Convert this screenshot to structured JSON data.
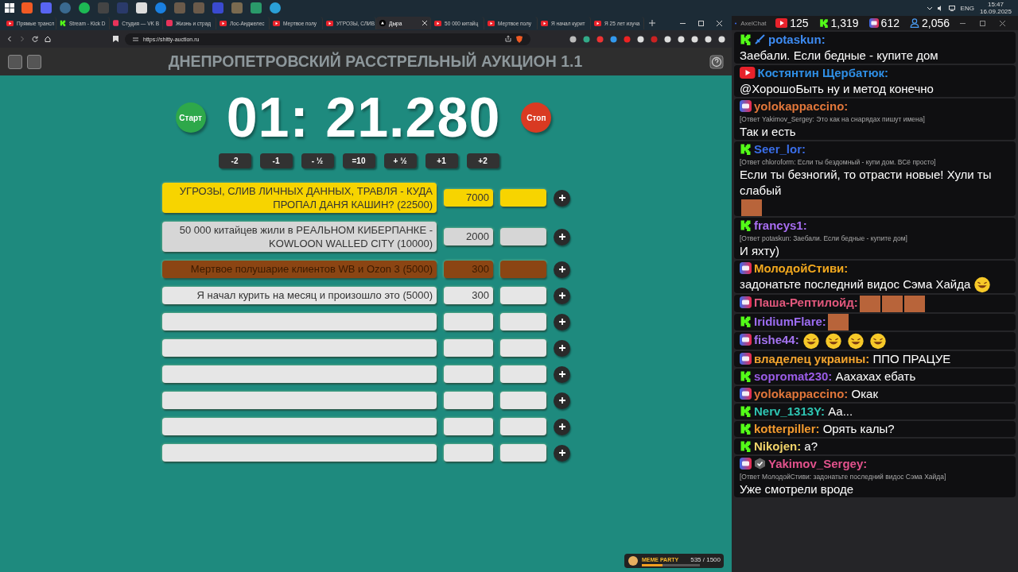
{
  "browser": {
    "tabs": [
      {
        "kind": "youtube",
        "label": "Прямые трансл",
        "selected": false
      },
      {
        "kind": "kick",
        "label": "Stream - Kick D",
        "selected": false
      },
      {
        "kind": "vk",
        "label": "Студия — VK В",
        "selected": false
      },
      {
        "kind": "vk",
        "label": "Жизнь и страд",
        "selected": false
      },
      {
        "kind": "youtube",
        "label": "Лос-Анджелес",
        "selected": false
      },
      {
        "kind": "youtube",
        "label": "Мертвое полу",
        "selected": false
      },
      {
        "kind": "youtube",
        "label": "УГРОЗЫ, СЛИВ",
        "selected": false
      },
      {
        "kind": "site",
        "label": "Дыра",
        "selected": true
      },
      {
        "kind": "youtube",
        "label": "50 000 китайц",
        "selected": false
      },
      {
        "kind": "youtube",
        "label": "Мертвое полу",
        "selected": false
      },
      {
        "kind": "youtube",
        "label": "Я начал курит",
        "selected": false
      },
      {
        "kind": "youtube",
        "label": "Я 25 лет изуча",
        "selected": false
      }
    ],
    "url": "https://shitty-auction.ru"
  },
  "auction": {
    "title": "ДНЕПРОПЕТРОВСКИЙ РАССТРЕЛЬНЫЙ АУКЦИОН 1.1",
    "start_button": "Старт",
    "timer": "01: 21.280",
    "stop_button": "Стоп",
    "time_buttons": [
      "-2",
      "-1",
      "- ½",
      "=10",
      "+ ½",
      "+1",
      "+2"
    ],
    "lots": [
      {
        "name": "УГРОЗЫ, СЛИВ ЛИЧНЫХ ДАННЫХ, ТРАВЛЯ - КУДА ПРОПАЛ ДАНЯ КАШИН? (22500)",
        "amount": "7000",
        "color": "#f7d400"
      },
      {
        "name": "50 000 китайцев жили в РЕАЛЬНОМ КИБЕРПАНКЕ - KOWLOON WALLED CITY (10000)",
        "amount": "2000",
        "color": "#d6d6d6"
      },
      {
        "name": "Мертвое полушарие клиентов WB и Ozon 3 (5000)",
        "amount": "300",
        "color": "#8b4513"
      },
      {
        "name": "Я начал курить на месяц и произошло это (5000)",
        "amount": "300",
        "color": "#e6e6e6"
      },
      {
        "color": "#e6e6e6"
      },
      {
        "color": "#e6e6e6"
      },
      {
        "color": "#e6e6e6"
      },
      {
        "color": "#e6e6e6"
      },
      {
        "color": "#e6e6e6"
      },
      {
        "color": "#e6e6e6"
      }
    ],
    "meme_party": {
      "label": "MEME PARTY",
      "reading": "535 / 1500",
      "level": 0.36
    }
  },
  "tray": {
    "language": "ENG",
    "time": "15:47",
    "date": "16.09.2025"
  },
  "chat": {
    "app_name": "AxelChat",
    "viewer_counts": [
      {
        "kind": "youtube",
        "count": "125"
      },
      {
        "kind": "kick",
        "count": "1,319"
      },
      {
        "kind": "vklive",
        "count": "612"
      },
      {
        "kind": "total",
        "count": "2,056"
      }
    ],
    "messages": [
      {
        "kind": "kick",
        "badges": [
          {
            "kind": "sword"
          }
        ],
        "name": "potaskun:",
        "color": "#3d8bf2",
        "text": "Заебали. Если бедные - купите дом"
      },
      {
        "kind": "youtube",
        "name": "Костянтин Щербатюк:",
        "color": "#2f8fe6",
        "text": "@ХорошоБыть ну и метод конечно"
      },
      {
        "kind": "vklive",
        "name": "yolokappaccino:",
        "color": "#e0763a",
        "reply": "[Ответ Yakimov_Sergey: Это как на снарядах пишут имена]",
        "text": "Так и есть"
      },
      {
        "kind": "kick",
        "name": "Seer_lor:",
        "color": "#3a6ee8",
        "reply": "[Ответ chloroform: Если ты бездомный - купи дом. ВСё просто]",
        "text": "Если ты безногий, то отрасти новые! Хули ты слабый",
        "emotes": [
          {
            "kind": "photo"
          }
        ]
      },
      {
        "kind": "kick",
        "name": "francys1:",
        "color": "#a86ef2",
        "reply": "[Ответ potaskun: Заебали. Если бедные - купите дом]",
        "text": "И яхту)"
      },
      {
        "kind": "vklive",
        "name": "МолодойСтиви:",
        "color": "#f2a81e",
        "text": "задонатьте последний видос Сэма Хайда",
        "emotes": [
          {
            "kind": "emoji"
          }
        ]
      },
      {
        "kind": "vklive",
        "name": "Паша-Рептилойд:",
        "color": "#e2587c",
        "emotes": [
          {
            "kind": "photo"
          },
          {
            "kind": "photo"
          },
          {
            "kind": "photo"
          }
        ]
      },
      {
        "kind": "kick",
        "name": "IridiumFlare:",
        "color": "#9c6cf2",
        "emotes": [
          {
            "kind": "photo"
          }
        ]
      },
      {
        "kind": "vklive",
        "name": "fishe44:",
        "color": "#a574f2",
        "emotes": [
          {
            "kind": "emoji"
          },
          {
            "kind": "emoji"
          },
          {
            "kind": "emoji"
          },
          {
            "kind": "emoji"
          }
        ]
      },
      {
        "kind": "vklive",
        "name": "владелец украины:",
        "color": "#f2a42e",
        "text": "ППО ПРАЦУЕ"
      },
      {
        "kind": "kick",
        "name": "sopromat230:",
        "color": "#9a5ce6",
        "text": "Аахахах ебать"
      },
      {
        "kind": "vklive",
        "name": "yolokappaccino:",
        "color": "#e0763a",
        "text": "Окак"
      },
      {
        "kind": "kick",
        "name": "Nerv_1313Y:",
        "color": "#2ec4b2",
        "text": "Аа..."
      },
      {
        "kind": "kick",
        "name": "kotterpiller:",
        "color": "#f29a2e",
        "text": "Орять калы?"
      },
      {
        "kind": "kick",
        "name": "Nikojen:",
        "color": "#f2d46a",
        "text": "а?"
      },
      {
        "kind": "vklive",
        "badges": [
          {
            "kind": "verified"
          }
        ],
        "name": "Yakimov_Sergey:",
        "color": "#e2528c",
        "reply": "[Ответ МолодойСтиви: задонатьте последний видос Сэма Хайда]",
        "text": "Уже смотрели вроде"
      }
    ]
  }
}
